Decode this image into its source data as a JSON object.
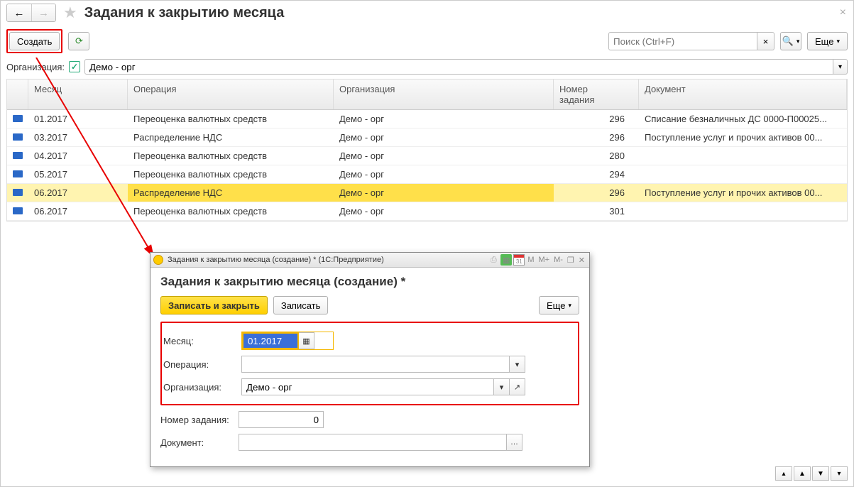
{
  "page_title": "Задания к закрытию месяца",
  "toolbar": {
    "create": "Создать",
    "search_placeholder": "Поиск (Ctrl+F)",
    "more": "Еще"
  },
  "filter": {
    "org_label": "Организация:",
    "org_value": "Демо - орг"
  },
  "columns": {
    "month": "Месяц",
    "operation": "Операция",
    "org": "Организация",
    "task_no": "Номер задания",
    "doc": "Документ"
  },
  "rows": [
    {
      "month": "01.2017",
      "op": "Переоценка валютных средств",
      "org": "Демо - орг",
      "num": "296",
      "doc": "Списание безналичных ДС 0000-П00025...",
      "sel": false
    },
    {
      "month": "03.2017",
      "op": "Распределение НДС",
      "org": "Демо - орг",
      "num": "296",
      "doc": "Поступление услуг и прочих активов 00...",
      "sel": false
    },
    {
      "month": "04.2017",
      "op": "Переоценка валютных средств",
      "org": "Демо - орг",
      "num": "280",
      "doc": "",
      "sel": false
    },
    {
      "month": "05.2017",
      "op": "Переоценка валютных средств",
      "org": "Демо - орг",
      "num": "294",
      "doc": "",
      "sel": false
    },
    {
      "month": "06.2017",
      "op": "Распределение НДС",
      "org": "Демо - орг",
      "num": "296",
      "doc": "Поступление услуг и прочих активов 00...",
      "sel": true
    },
    {
      "month": "06.2017",
      "op": "Переоценка валютных средств",
      "org": "Демо - орг",
      "num": "301",
      "doc": "",
      "sel": false
    }
  ],
  "dialog": {
    "win_title": "Задания к закрытию месяца (создание) *  (1С:Предприятие)",
    "heading": "Задания к закрытию месяца (создание) *",
    "save_close": "Записать и закрыть",
    "save": "Записать",
    "more": "Еще",
    "labels": {
      "month": "Месяц:",
      "operation": "Операция:",
      "org": "Организация:",
      "task_no": "Номер задания:",
      "doc": "Документ:"
    },
    "values": {
      "month": "01.2017",
      "operation": "",
      "org": "Демо - орг",
      "task_no": "0",
      "doc": ""
    },
    "title_tools": {
      "m": "M",
      "m_plus": "M+",
      "m_minus": "M-"
    }
  }
}
